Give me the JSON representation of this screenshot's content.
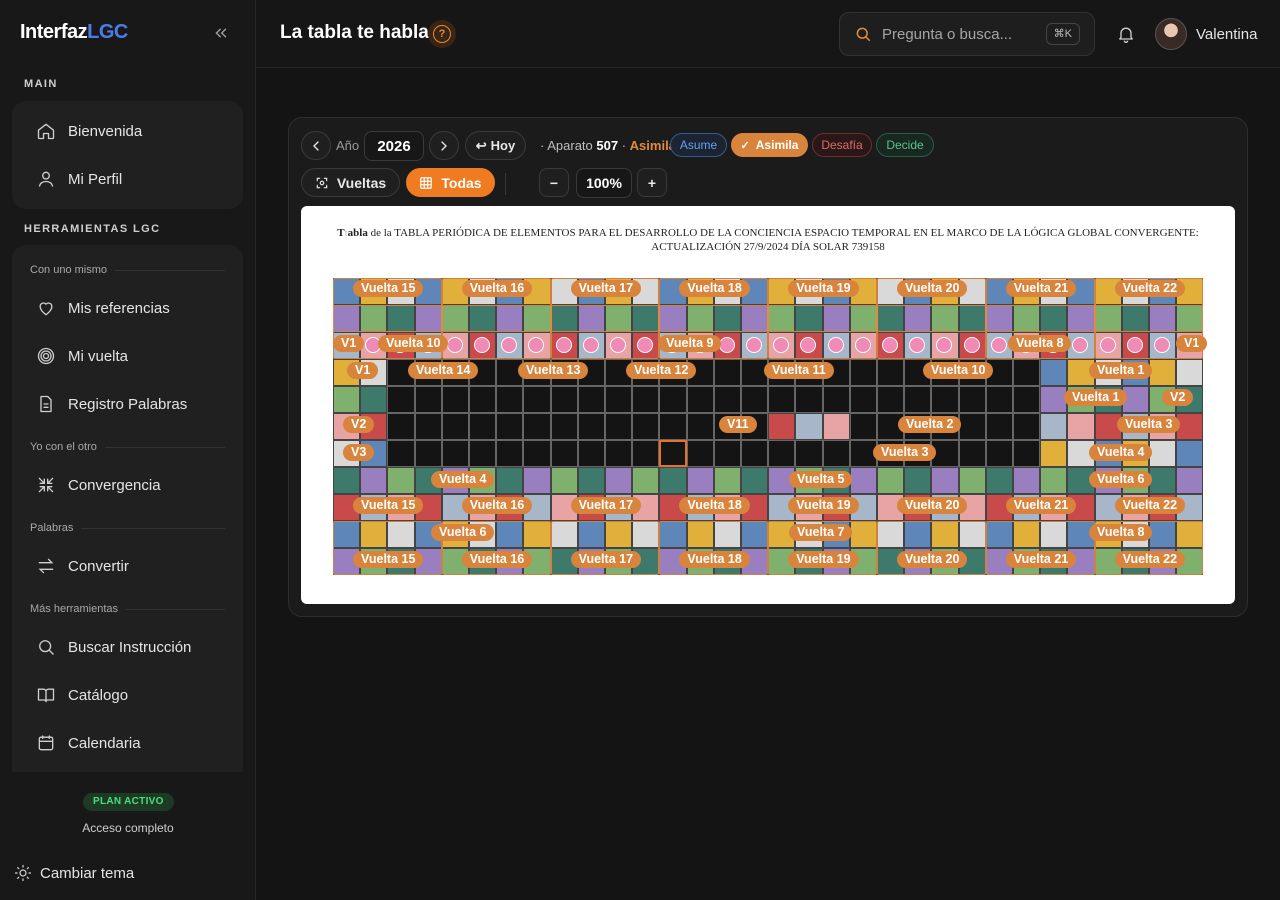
{
  "brand": {
    "name_main": "Interfaz",
    "name_accent": "LGC"
  },
  "sidebar": {
    "main_title": "MAIN",
    "main_items": [
      {
        "label": "Bienvenida",
        "icon": "home-icon"
      },
      {
        "label": "Mi Perfil",
        "icon": "user-icon"
      }
    ],
    "tools_title": "HERRAMIENTAS LGC",
    "groups": [
      {
        "label": "Con uno mismo",
        "items": [
          {
            "label": "Mis referencias",
            "icon": "heart-icon"
          },
          {
            "label": "Mi vuelta",
            "icon": "spiral-icon"
          },
          {
            "label": "Registro Palabras",
            "icon": "document-icon"
          }
        ]
      },
      {
        "label": "Yo con el otro",
        "items": [
          {
            "label": "Convergencia",
            "icon": "converge-icon"
          }
        ]
      },
      {
        "label": "Palabras",
        "items": [
          {
            "label": "Convertir",
            "icon": "swap-icon"
          }
        ]
      },
      {
        "label": "Más herramientas",
        "items": [
          {
            "label": "Buscar Instrucción",
            "icon": "search-icon"
          },
          {
            "label": "Catálogo",
            "icon": "book-icon"
          },
          {
            "label": "Calendaria",
            "icon": "calendar-icon"
          }
        ]
      }
    ],
    "plan_badge": "PLAN ACTIVO",
    "plan_sub": "Acceso completo",
    "theme_label": "Cambiar tema"
  },
  "header": {
    "title": "La tabla te habla",
    "search_placeholder": "Pregunta o busca...",
    "search_shortcut": "⌘K",
    "user_name": "Valentina"
  },
  "toolbar": {
    "year_label": "Año",
    "year": "2026",
    "today_label": "Hoy",
    "aparato_label": "Aparato",
    "aparato_value": "507",
    "aparato_mode": "Asimila",
    "filters": [
      "Asume",
      "Asimila",
      "Desafía",
      "Decide"
    ],
    "active_filter": "Asimila",
    "view_vueltas": "Vueltas",
    "view_todas": "Todas",
    "zoom": "100%"
  },
  "document": {
    "title_line1_prefix": "T",
    "title_line1_bold": "abla",
    "title_line1_rest": " de la TABLA PERIÓDICA DE ELEMENTOS PARA EL DESARROLLO DE LA CONCIENCIA ESPACIO TEMPORAL EN EL MARCO DE LA LÓGICA GLOBAL CONVERGENTE:",
    "title_line2": "ACTUALIZACIÓN 27/9/2024 DÍA SOLAR 739158"
  },
  "vuelta_labels": {
    "row_top": [
      "Vuelta 15",
      "Vuelta 16",
      "Vuelta 17",
      "Vuelta 18",
      "Vuelta 19",
      "Vuelta 20",
      "Vuelta 21",
      "Vuelta 22"
    ],
    "row_mid": [
      "V1",
      "Vuelta 10",
      "Vuelta 9",
      "Vuelta 8",
      "V1"
    ],
    "row_3": [
      "V1",
      "Vuelta 14",
      "Vuelta 13",
      "Vuelta 12",
      "Vuelta 11",
      "Vuelta 10",
      "Vuelta 1"
    ],
    "row_4": [
      "Vuelta 1",
      "V2"
    ],
    "row_5": [
      "V2",
      "V11",
      "Vuelta 2",
      "Vuelta 3"
    ],
    "row_6": [
      "V3",
      "Vuelta 3",
      "Vuelta 4"
    ],
    "row_7": [
      "Vuelta 4",
      "Vuelta 5",
      "Vuelta 6"
    ],
    "row_10": [
      "Vuelta 6",
      "Vuelta 7",
      "Vuelta 8"
    ]
  },
  "colors": {
    "accent": "#f07c22",
    "vuelta": "#d8843c",
    "brand_accent": "#4a7dea",
    "plan": "#4ade80"
  }
}
